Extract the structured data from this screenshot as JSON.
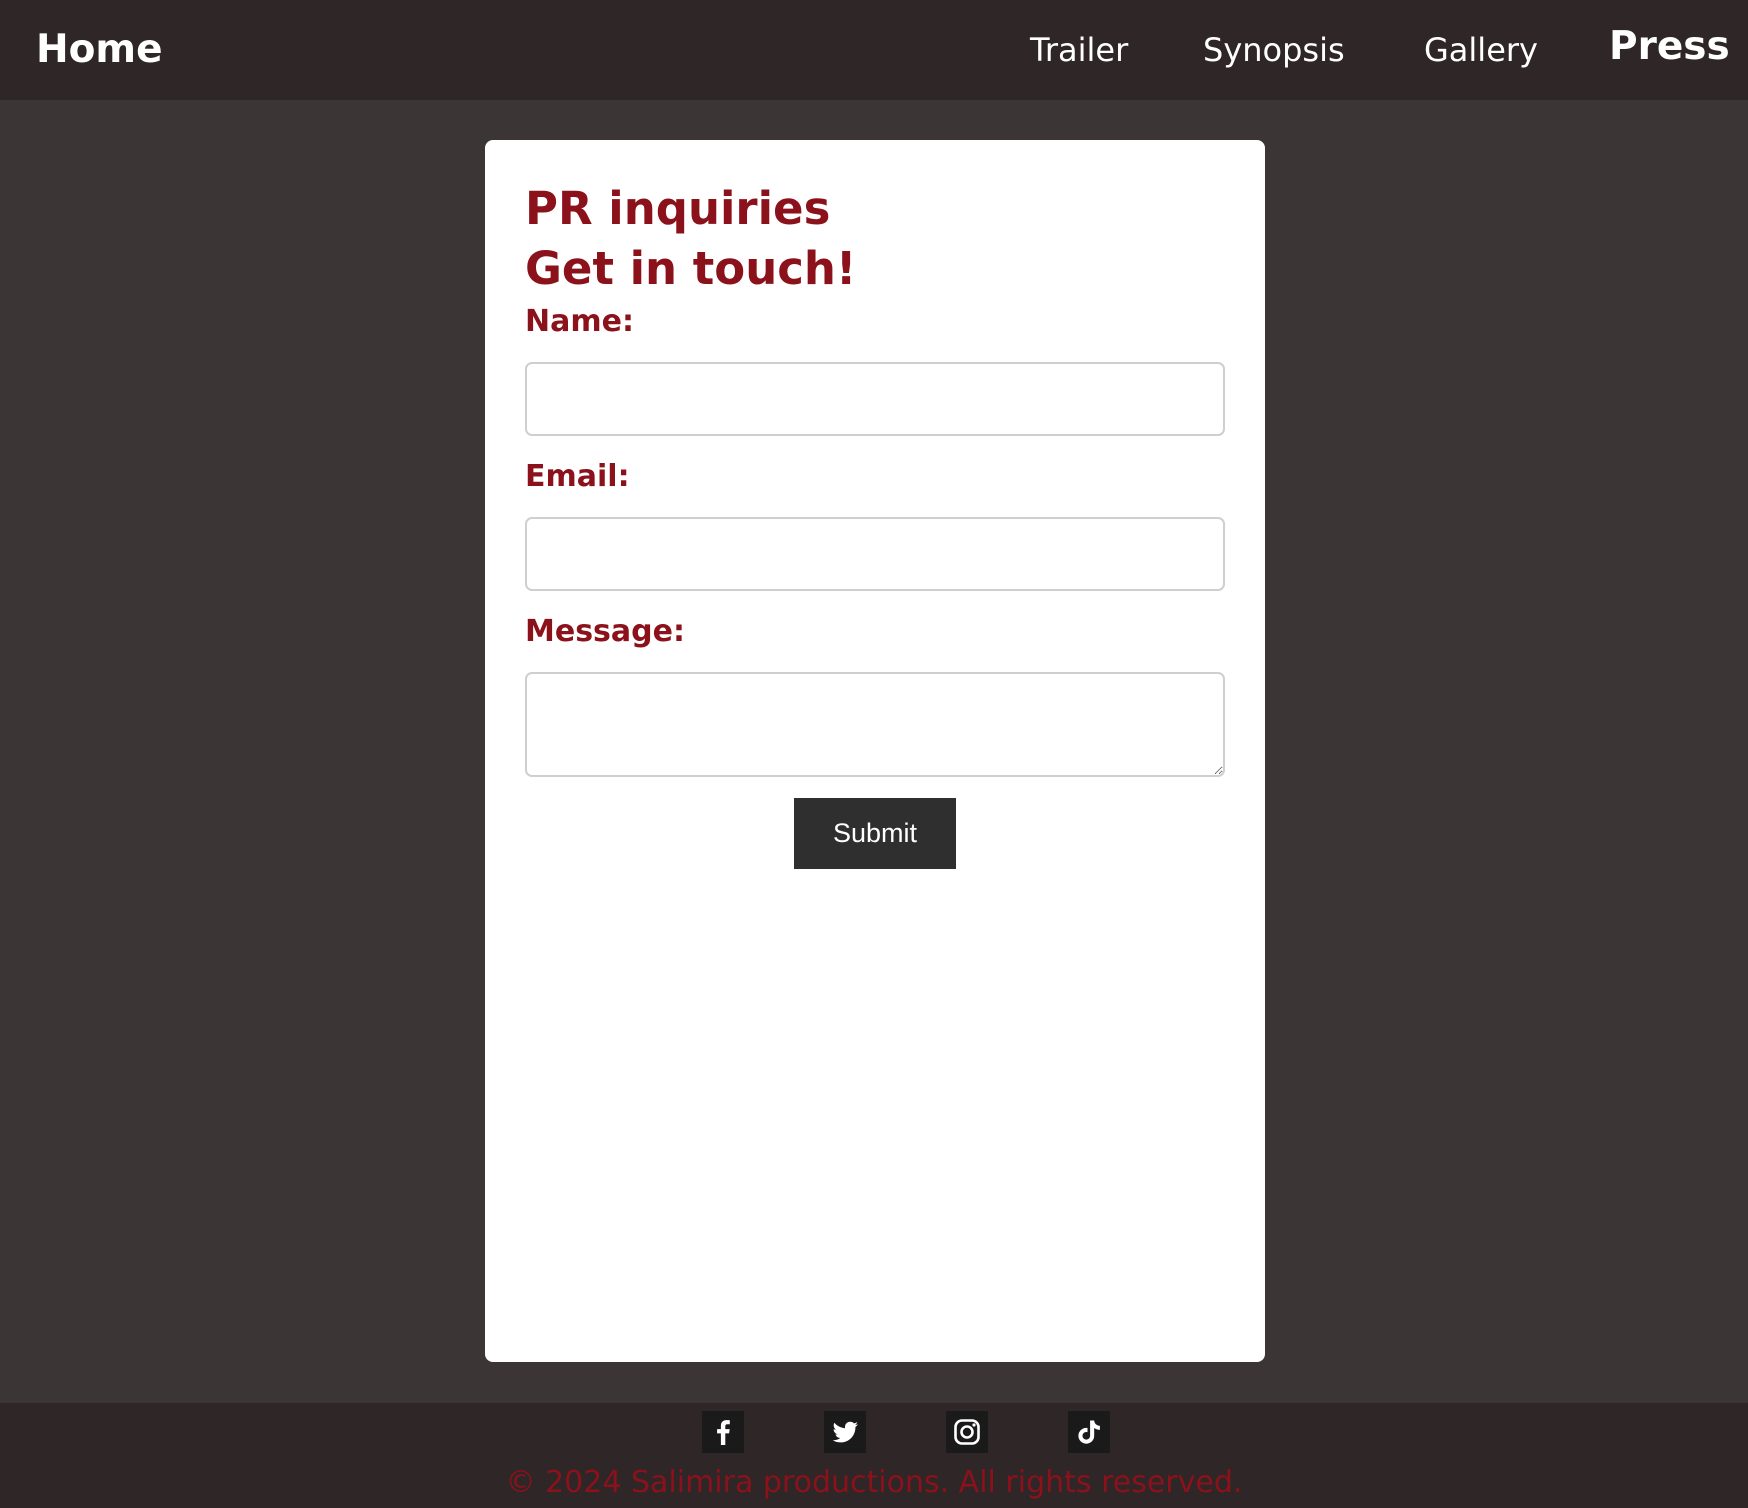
{
  "nav": {
    "home_label": "Home",
    "links": [
      {
        "label": "Trailer"
      },
      {
        "label": "Synopsis"
      },
      {
        "label": "Gallery"
      },
      {
        "label": "Press"
      }
    ],
    "active": "Press"
  },
  "form": {
    "title_line1": "PR inquiries",
    "title_line2": "Get in touch!",
    "name_label": "Name:",
    "name_value": "",
    "email_label": "Email:",
    "email_value": "",
    "message_label": "Message:",
    "message_value": "",
    "submit_label": "Submit"
  },
  "footer": {
    "social_icons": [
      "facebook-icon",
      "twitter-icon",
      "instagram-icon",
      "tiktok-icon"
    ],
    "copyright": "© 2024 Salimira productions. All rights reserved."
  },
  "colors": {
    "page_background": "#3b3535",
    "navbar_background": "#2e2627",
    "accent_red": "#8b111b",
    "card_background": "#ffffff",
    "button_background": "#2f2f2f"
  }
}
